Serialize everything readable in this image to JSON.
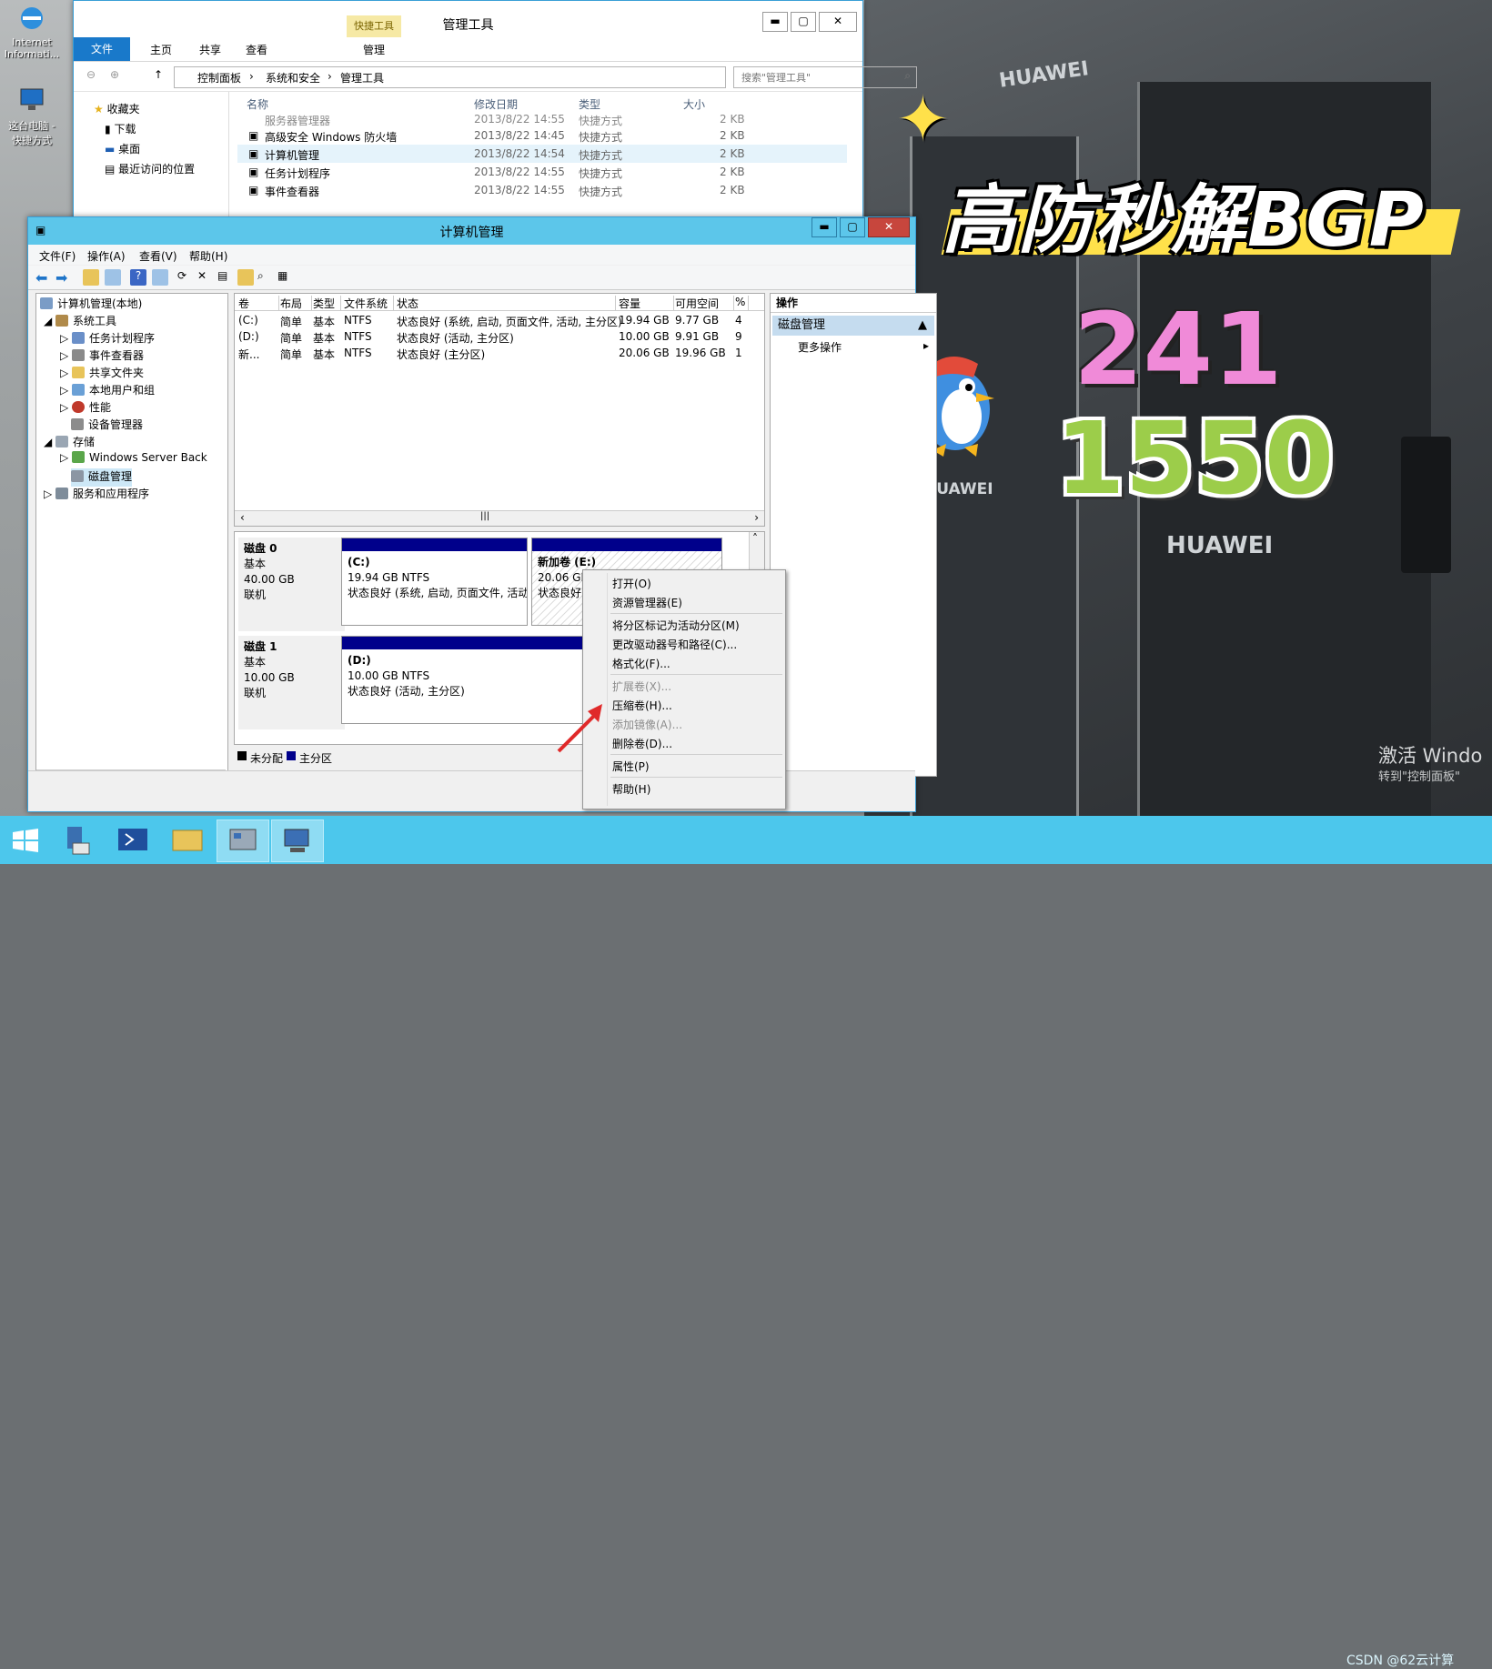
{
  "desktop": {
    "icons": [
      {
        "label_line1": "Internet",
        "label_line2": "Informati..."
      },
      {
        "label_line1": "这台电脑 -",
        "label_line2": "快捷方式"
      }
    ]
  },
  "explorer": {
    "title": "管理工具",
    "context_tab_group": "快捷工具",
    "ribbon_tabs": [
      "文件",
      "主页",
      "共享",
      "查看",
      "管理"
    ],
    "breadcrumb": [
      "控制面板",
      "系统和安全",
      "管理工具"
    ],
    "search_placeholder": "搜索\"管理工具\"",
    "nav": [
      "收藏夹",
      "下载",
      "桌面",
      "最近访问的位置"
    ],
    "columns": [
      "名称",
      "修改日期",
      "类型",
      "大小"
    ],
    "files": [
      {
        "name": "服务器管理器",
        "date": "2013/8/22 14:55",
        "type": "快捷方式",
        "size": "2 KB"
      },
      {
        "name": "高级安全 Windows 防火墙",
        "date": "2013/8/22 14:45",
        "type": "快捷方式",
        "size": "2 KB"
      },
      {
        "name": "计算机管理",
        "date": "2013/8/22 14:54",
        "type": "快捷方式",
        "size": "2 KB"
      },
      {
        "name": "任务计划程序",
        "date": "2013/8/22 14:55",
        "type": "快捷方式",
        "size": "2 KB"
      },
      {
        "name": "事件查看器",
        "date": "2013/8/22 14:55",
        "type": "快捷方式",
        "size": "2 KB"
      }
    ]
  },
  "cm": {
    "title": "计算机管理",
    "menu": [
      "文件(F)",
      "操作(A)",
      "查看(V)",
      "帮助(H)"
    ],
    "tree": [
      {
        "label": "计算机管理(本地)",
        "depth": 0
      },
      {
        "label": "系统工具",
        "depth": 1
      },
      {
        "label": "任务计划程序",
        "depth": 2
      },
      {
        "label": "事件查看器",
        "depth": 2
      },
      {
        "label": "共享文件夹",
        "depth": 2
      },
      {
        "label": "本地用户和组",
        "depth": 2
      },
      {
        "label": "性能",
        "depth": 2
      },
      {
        "label": "设备管理器",
        "depth": 2
      },
      {
        "label": "存储",
        "depth": 1
      },
      {
        "label": "Windows Server Back",
        "depth": 2
      },
      {
        "label": "磁盘管理",
        "depth": 2
      },
      {
        "label": "服务和应用程序",
        "depth": 1
      }
    ],
    "volume_columns": [
      "卷",
      "布局",
      "类型",
      "文件系统",
      "状态",
      "容量",
      "可用空间",
      "%"
    ],
    "volumes": [
      {
        "vol": "(C:)",
        "layout": "简单",
        "type": "基本",
        "fs": "NTFS",
        "status": "状态良好 (系统, 启动, 页面文件, 活动, 主分区)",
        "cap": "19.94 GB",
        "free": "9.77 GB",
        "pct": "4"
      },
      {
        "vol": "(D:)",
        "layout": "简单",
        "type": "基本",
        "fs": "NTFS",
        "status": "状态良好 (活动, 主分区)",
        "cap": "10.00 GB",
        "free": "9.91 GB",
        "pct": "9"
      },
      {
        "vol": "新...",
        "layout": "简单",
        "type": "基本",
        "fs": "NTFS",
        "status": "状态良好 (主分区)",
        "cap": "20.06 GB",
        "free": "19.96 GB",
        "pct": "1"
      }
    ],
    "disks": [
      {
        "name": "磁盘 0",
        "kind": "基本",
        "size": "40.00 GB",
        "state": "联机"
      },
      {
        "name": "磁盘 1",
        "kind": "基本",
        "size": "10.00 GB",
        "state": "联机"
      }
    ],
    "partitions": [
      {
        "title": "(C:)",
        "size": "19.94 GB NTFS",
        "status": "状态良好 (系统, 启动, 页面文件, 活动,"
      },
      {
        "title": "新加卷  (E:)",
        "size": "20.06 GB NTFS",
        "status": "状态良好 (主分区)"
      },
      {
        "title": "(D:)",
        "size": "10.00 GB NTFS",
        "status": "状态良好 (活动, 主分区)"
      }
    ],
    "legend": [
      "未分配",
      "主分区"
    ],
    "actions_header": "操作",
    "actions_section": "磁盘管理",
    "actions_more": "更多操作"
  },
  "context_menu": {
    "items": [
      {
        "label": "打开(O)",
        "disabled": false
      },
      {
        "label": "资源管理器(E)",
        "disabled": false
      },
      {
        "label": "将分区标记为活动分区(M)",
        "disabled": false
      },
      {
        "label": "更改驱动器号和路径(C)...",
        "disabled": false
      },
      {
        "label": "格式化(F)...",
        "disabled": false
      },
      {
        "label": "扩展卷(X)...",
        "disabled": true
      },
      {
        "label": "压缩卷(H)...",
        "disabled": false
      },
      {
        "label": "添加镜像(A)...",
        "disabled": true
      },
      {
        "label": "删除卷(D)...",
        "disabled": false
      },
      {
        "label": "属性(P)",
        "disabled": false
      },
      {
        "label": "帮助(H)",
        "disabled": false
      }
    ]
  },
  "promo": {
    "title": "高防秒解BGP",
    "number1": "241",
    "number2": "1550",
    "brand": "HUAWEI"
  },
  "overlay": {
    "activate_line1": "激活 Windo",
    "activate_line2": "转到\"控制面板\"",
    "watermark": "CSDN @62云计算"
  },
  "colors": {
    "titlebar": "#5cc6ea",
    "taskbar": "#4cc7ec",
    "partition_bar": "#00008b",
    "promo_yellow": "#ffe14a"
  }
}
